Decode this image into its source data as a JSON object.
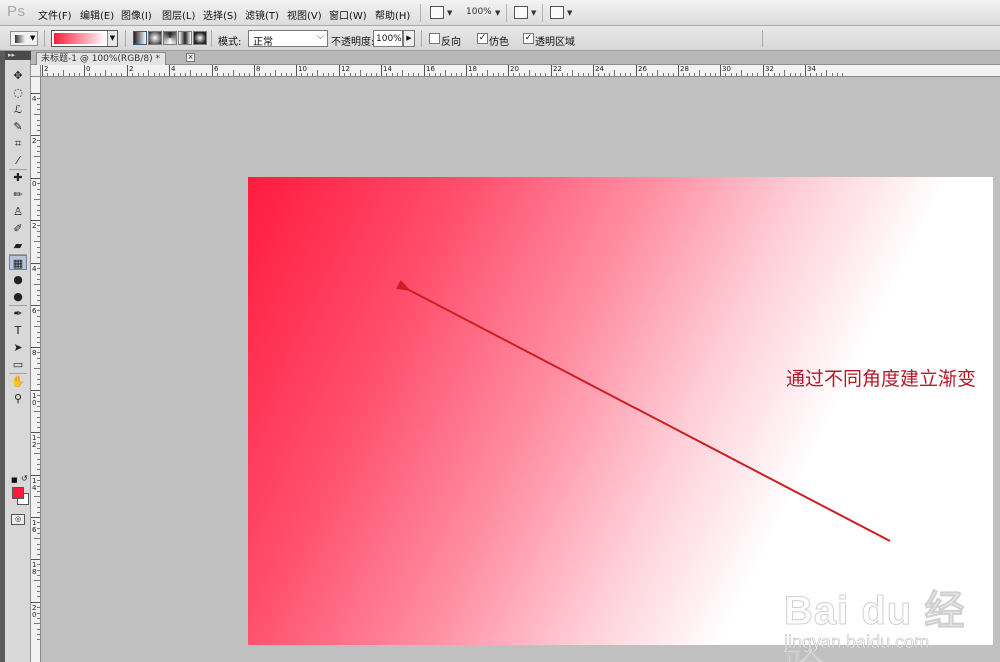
{
  "app": {
    "logo": "Ps",
    "menu": [
      "文件(F)",
      "编辑(E)",
      "图像(I)",
      "图层(L)",
      "选择(S)",
      "滤镜(T)",
      "视图(V)",
      "窗口(W)",
      "帮助(H)"
    ],
    "zoom_level": "100%"
  },
  "options_bar": {
    "mode_label": "模式:",
    "mode_value": "正常",
    "opacity_label": "不透明度:",
    "opacity_value": "100%",
    "reverse_label": "反向",
    "reverse_checked": false,
    "dither_label": "仿色",
    "dither_checked": true,
    "transparency_label": "透明区域",
    "transparency_checked": true,
    "gradient_colors": [
      "#ff1a3c",
      "#ffffff"
    ]
  },
  "toolbox": {
    "header": "▸▸",
    "tools": [
      "move-icon",
      "marquee-icon",
      "lasso-icon",
      "quick-select-icon",
      "crop-icon",
      "eyedropper-icon",
      "healing-brush-icon",
      "brush-icon",
      "clone-stamp-icon",
      "history-brush-icon",
      "eraser-icon",
      "gradient-icon",
      "blur-icon",
      "dodge-icon",
      "pen-icon",
      "type-icon",
      "path-select-icon",
      "shape-icon",
      "hand-icon",
      "zoom-icon"
    ],
    "tool_glyphs": [
      "✥",
      "◌",
      "ℒ",
      "✎",
      "⌗",
      "⁄",
      "✚",
      "✏",
      "♙",
      "✐",
      "▰",
      "▦",
      "●",
      "●",
      "✒",
      "T",
      "➤",
      "▭",
      "✋",
      "⚲"
    ],
    "foreground_color": "#ff1a3c",
    "background_color": "#ffffff"
  },
  "document": {
    "tab_title": "未标题-1 @ 100%(RGB/8) *",
    "close_glyph": "×"
  },
  "rulers": {
    "top_labels": [
      "2",
      "0",
      "2",
      "4",
      "6",
      "8",
      "10",
      "12",
      "14",
      "16",
      "18",
      "20",
      "22",
      "24",
      "26",
      "28",
      "30",
      "32",
      "34"
    ],
    "left_labels": [
      "4",
      "2",
      "0",
      "2",
      "4",
      "6",
      "8",
      "10",
      "12",
      "14",
      "16",
      "18",
      "20"
    ]
  },
  "canvas": {
    "annotation": "通过不同角度建立渐变",
    "arrow_color": "#cc1f1f"
  },
  "watermark": {
    "logo_text": "Bai du 经验",
    "url": "jingyan.baidu.com"
  }
}
